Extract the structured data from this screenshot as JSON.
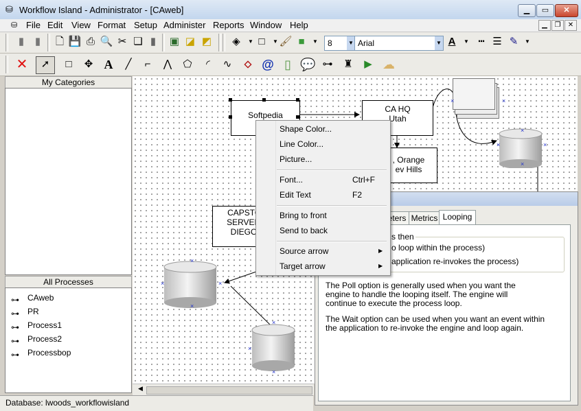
{
  "window": {
    "title": "Workflow Island - Administrator - [CAweb]"
  },
  "menu": [
    "File",
    "Edit",
    "View",
    "Format",
    "Setup",
    "Administer",
    "Reports",
    "Window",
    "Help"
  ],
  "format_toolbar": {
    "font_size": "8",
    "font_name": "Arial"
  },
  "panels": {
    "categories_title": "My Categories",
    "processes_title": "All Processes",
    "processes": [
      "CAweb",
      "PR",
      "Process1",
      "Process2",
      "Processbop"
    ]
  },
  "diagram": {
    "softpedia": "Softpedia",
    "ca_hq_1": "CA HQ",
    "ca_hq_2": "Utah",
    "orange_1": ", Orange",
    "orange_2": "ev Hills",
    "capstone_1": "CAPSTON",
    "capstone_2": "SERVER A",
    "capstone_3": "DIEGO L"
  },
  "context_menu": {
    "items": [
      {
        "label": "Shape Color...",
        "shortcut": ""
      },
      {
        "label": "Line Color...",
        "shortcut": ""
      },
      {
        "label": "Picture...",
        "shortcut": ""
      },
      {
        "label": "Font...",
        "shortcut": "Ctrl+F"
      },
      {
        "label": "Edit Text",
        "shortcut": "F2"
      },
      {
        "label": "Bring to front",
        "shortcut": ""
      },
      {
        "label": "Send to back",
        "shortcut": ""
      },
      {
        "label": "Source arrow",
        "shortcut": ""
      },
      {
        "label": "Target arrow",
        "shortcut": ""
      }
    ]
  },
  "dialog": {
    "tabs": [
      "eters",
      "Metrics",
      "Looping"
    ],
    "group_title": "s then",
    "option_1": "o loop within the process)",
    "option_2": "application re-invokes the process)",
    "help_1": "The Poll option is generally used when you want the engine to handle the looping itself.  The engine will continue to execute the process loop.",
    "help_2": "The Wait option can be used when you want an event within the application to re-invoke the engine and loop again."
  },
  "status": {
    "text": "Database: lwoods_workflowisland"
  },
  "colors": {
    "xmark": "#2233cc",
    "selection_handle": "#000000",
    "cloud": "#d9b36a",
    "speech": "#9ec4ea"
  }
}
